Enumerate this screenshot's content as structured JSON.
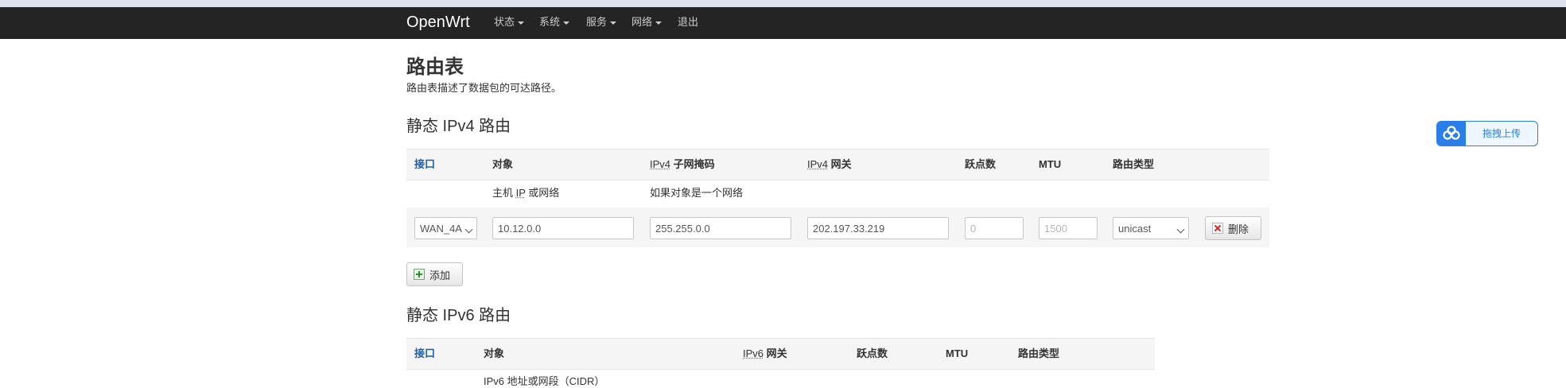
{
  "navbar": {
    "brand": "OpenWrt",
    "items": [
      {
        "label": "状态"
      },
      {
        "label": "系统"
      },
      {
        "label": "服务"
      },
      {
        "label": "网络"
      },
      {
        "label": "退出"
      }
    ]
  },
  "page": {
    "title": "路由表",
    "description": "路由表描述了数据包的可达路径。"
  },
  "ipv4": {
    "section_title": "静态 IPv4 路由",
    "headers": {
      "interface": "接口",
      "target": "对象",
      "netmask_abbr": "IPv4",
      "netmask_rest": " 子网掩码",
      "gateway_abbr": "IPv4",
      "gateway_rest": " 网关",
      "metric": "跃点数",
      "mtu": "MTU",
      "route_type": "路由类型"
    },
    "descriptions": {
      "target_pre": "主机 ",
      "target_abbr": "IP",
      "target_post": " 或网络",
      "netmask": "如果对象是一个网络"
    },
    "row": {
      "interface": "WAN_4A",
      "target": "10.12.0.0",
      "netmask": "255.255.0.0",
      "gateway": "202.197.33.219",
      "metric_placeholder": "0",
      "mtu_placeholder": "1500",
      "route_type": "unicast",
      "delete_label": "删除"
    },
    "add_label": "添加"
  },
  "ipv6": {
    "section_title": "静态 IPv6 路由",
    "headers": {
      "interface": "接口",
      "target": "对象",
      "gateway_abbr": "IPv6",
      "gateway_rest": " 网关",
      "metric": "跃点数",
      "mtu": "MTU",
      "route_type": "路由类型"
    },
    "descriptions": {
      "target": "IPv6 地址或网段（CIDR）"
    }
  },
  "upload_widget": {
    "label": "拖拽上传",
    "icon": "cloud-icon",
    "accent": "#2b7de9"
  }
}
